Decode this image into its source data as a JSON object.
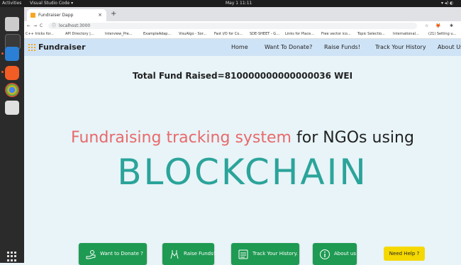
{
  "system": {
    "activities": "Activities",
    "app_name": "Visual Studio Code ▾",
    "clock": "May 1 11:11",
    "tray": "▾ ◂) ◐"
  },
  "browser": {
    "tab_title": "Fundraiser Dapp",
    "tab_close": "×",
    "new_tab": "+",
    "url": "localhost:3000",
    "bookmarks": [
      "C++ tricks for...",
      "API Directory |...",
      "Interview_Pre...",
      "ExampleAdap...",
      "VisuAlgo - Sor...",
      "Fast I/O for Co...",
      "SDE-SHEET - G...",
      "Links for Place...",
      "Free vector ico...",
      "Topic Selectio...",
      "International...",
      "(21) Setting u..."
    ]
  },
  "nav": {
    "brand": "Fundraiser",
    "links": [
      "Home",
      "Want To Donate?",
      "Raise Funds!",
      "Track Your History",
      "About Us"
    ]
  },
  "main": {
    "total": "Total Fund Raised=810000000000000036 WEI",
    "headline_red": "Fundraising tracking system",
    "headline_black": " for NGOs using",
    "big": "BLOCKCHAIN"
  },
  "buttons": [
    {
      "label": "Want to Donate ?",
      "icon": "donate-hand-icon"
    },
    {
      "label": "Raise Funds!",
      "icon": "raise-hands-icon"
    },
    {
      "label": "Track Your History.",
      "icon": "history-list-icon"
    },
    {
      "label": "About us",
      "icon": "info-icon"
    }
  ],
  "help": "Need Help ?",
  "colors": {
    "navbar": "#cfe3f6",
    "headline_red": "#e8696b",
    "blockchain_teal": "#2ba49a",
    "button_green": "#1e9a52",
    "help_yellow": "#f5d800"
  }
}
